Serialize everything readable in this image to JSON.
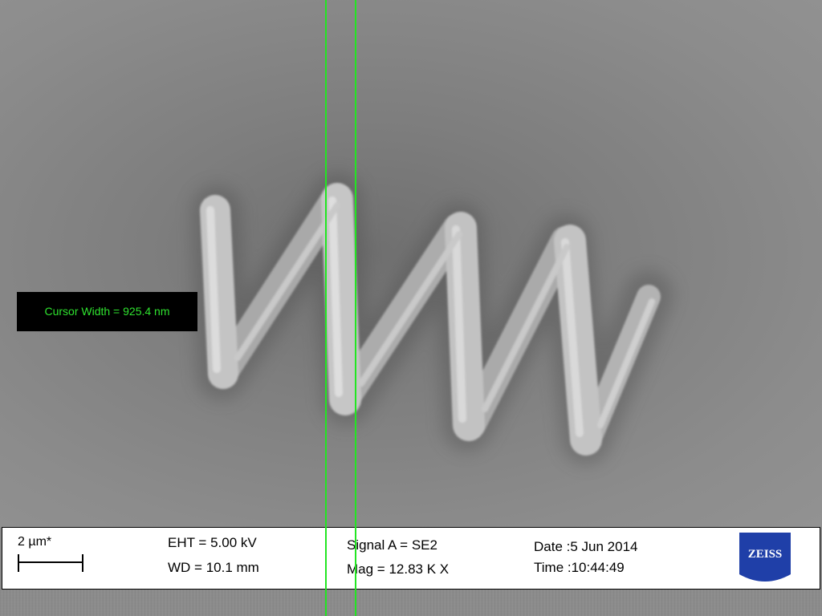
{
  "cursor": {
    "readout": "Cursor Width = 925.4 nm"
  },
  "info_bar": {
    "scale_label": "2 µm*",
    "eht": "EHT =  5.00 kV",
    "wd": "WD = 10.1 mm",
    "signal": "Signal A = SE2",
    "mag": "Mag =  12.83 K X",
    "date": "Date :5 Jun 2014",
    "time": "Time :10:44:49",
    "logo_text": "ZEISS"
  },
  "colors": {
    "cursor": "#22e622",
    "logo_blue": "#1f3fa8"
  }
}
